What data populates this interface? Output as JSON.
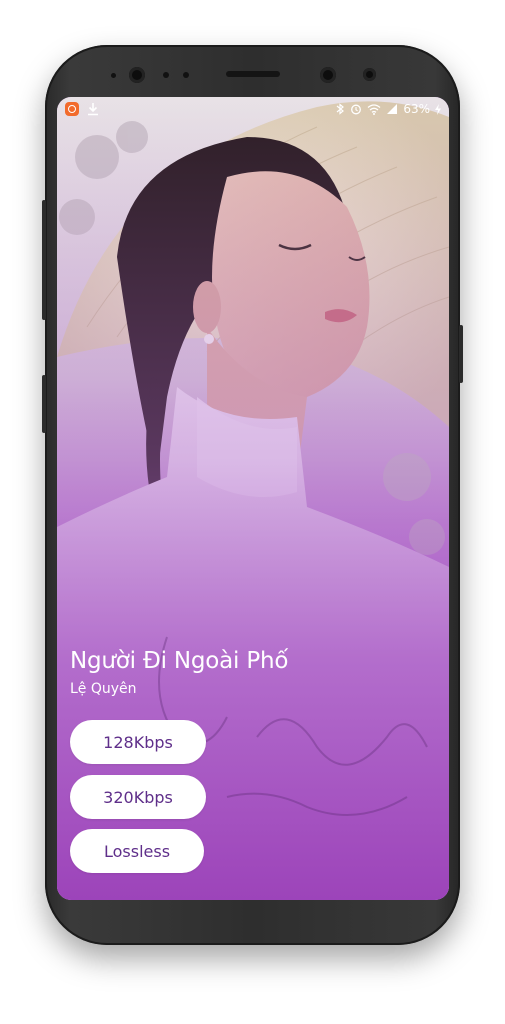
{
  "status_bar": {
    "battery_percent": "63%",
    "icons": [
      "app-notification-icon",
      "download-icon",
      "bluetooth-icon",
      "alarm-icon",
      "wifi-icon",
      "signal-icon",
      "charging-icon"
    ]
  },
  "song": {
    "title": "Người Đi Ngoài Phố",
    "artist": "Lệ Quyên"
  },
  "quality_options": [
    {
      "label": "128Kbps"
    },
    {
      "label": "320Kbps"
    },
    {
      "label": "Lossless"
    }
  ],
  "colors": {
    "phone_frame": "#2e2e2e",
    "screen_overlay_purple": "#a45bc4",
    "button_text": "#5f2f8a",
    "button_bg": "#ffffff"
  }
}
